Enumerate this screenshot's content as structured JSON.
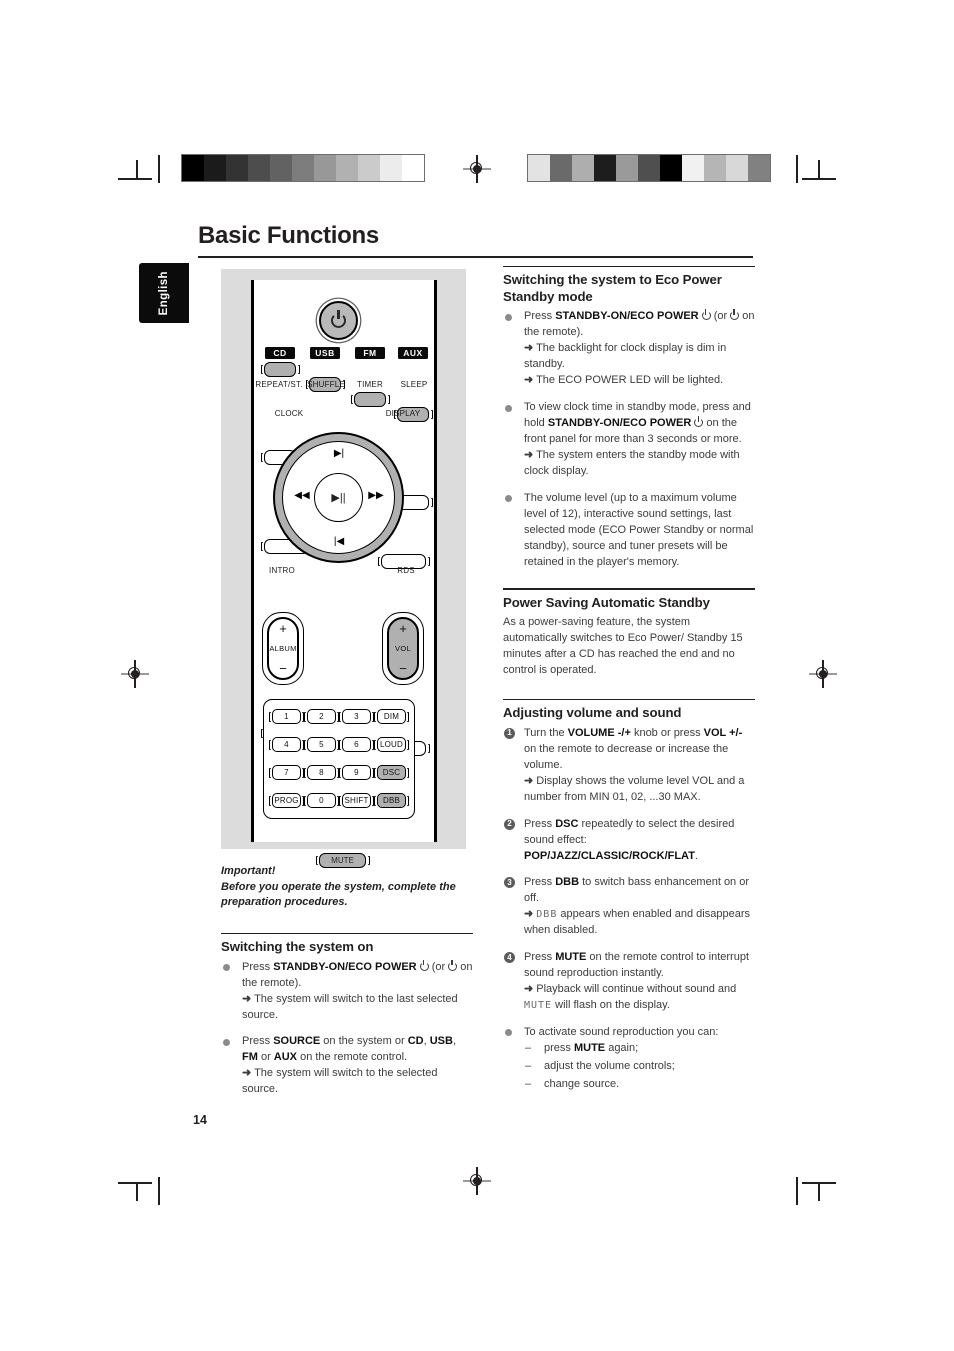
{
  "page": {
    "title": "Basic Functions",
    "number": "14",
    "language_tab": "English"
  },
  "print_marks": {
    "left_bar_swatches": [
      "#000000",
      "#1b1b1b",
      "#333333",
      "#4d4d4d",
      "#626262",
      "#7d7d7d",
      "#989898",
      "#b1b1b1",
      "#cbcbcb",
      "#ececec",
      "#ffffff"
    ],
    "right_bar_swatches": [
      "#e3e3e3",
      "#6a6a6a",
      "#aeaeae",
      "#1d1d1d",
      "#9a9a9a",
      "#4f4f4f",
      "#000000",
      "#f1f1f1",
      "#b5b5b5",
      "#d8d8d8",
      "#818181"
    ]
  },
  "remote": {
    "power_button": "power-icon",
    "source_tags": [
      "CD",
      "USB",
      "FM",
      "AUX"
    ],
    "row2_labels": [
      "REPEAT/ST.",
      "SHUFFLE",
      "TIMER",
      "SLEEP"
    ],
    "row3_labels": [
      "CLOCK",
      "DISPLAY"
    ],
    "nav": {
      "up": "▶|",
      "left": "◀◀",
      "right": "▶▶",
      "down": "|◀",
      "center": "▶||"
    },
    "nav_side_labels": [
      "INTRO",
      "RDS"
    ],
    "album_rocker": {
      "plus": "+",
      "name": "ALBUM",
      "minus": "−"
    },
    "vol_rocker": {
      "plus": "+",
      "name": "VOL",
      "minus": "−"
    },
    "stop_button": "■",
    "mute_button": "MUTE",
    "keypad": [
      [
        "1",
        "2",
        "3",
        "DIM"
      ],
      [
        "4",
        "5",
        "6",
        "LOUD"
      ],
      [
        "7",
        "8",
        "9",
        "DSC"
      ],
      [
        "PROG",
        "0",
        "SHIFT",
        "DBB"
      ]
    ],
    "keypad_shaded": [
      "DSC",
      "DBB"
    ]
  },
  "left_column": {
    "important_heading": "Important!",
    "important_text": "Before you operate the system, complete the preparation procedures.",
    "section_title": "Switching the system on",
    "bullets": [
      {
        "lead": "Press ",
        "bold1": "STANDBY-ON/ECO POWER",
        "after1": " ⏻ (or ⏻ on the remote).",
        "arrows": [
          "The system will switch to the last selected source."
        ]
      },
      {
        "lead": "Press ",
        "bold1": "SOURCE",
        "after1": " on the system or CD, USB, FM or AUX on the remote control.",
        "arrows": [
          "The system will switch to the selected source."
        ]
      }
    ]
  },
  "right_column": {
    "section1_title": "Switching the system to Eco Power Standby mode",
    "section1_bullets": [
      {
        "text_before": "Press ",
        "bold": "STANDBY-ON/ECO POWER",
        "text_after": " ⏻ (or ⏻ on the remote).",
        "arrows": [
          "The backlight for clock display is dim in standby.",
          "The ECO POWER LED will be lighted."
        ]
      },
      {
        "text_before": "To view clock time in standby mode, press and hold ",
        "bold": "STANDBY-ON/ECO POWER",
        "text_after": " ⏻ on the front panel for more than 3 seconds or more.",
        "arrows": [
          "The system enters the standby mode with clock display."
        ]
      },
      {
        "text_before": "The volume level (up to a maximum volume level of 12), interactive sound settings, last selected mode (ECO Power  Standby or normal standby), source and tuner presets will be retained in the player's memory.",
        "bold": "",
        "text_after": "",
        "arrows": []
      }
    ],
    "section2_title": "Power Saving Automatic Standby",
    "section2_body": "As a power-saving feature, the system automatically switches to Eco Power/ Standby 15 minutes after a CD has reached the end and no control is operated.",
    "section3_title": "Adjusting volume and sound",
    "section3_steps": [
      {
        "num": "1",
        "segments": [
          {
            "t": "Turn the ",
            "b": false
          },
          {
            "t": "VOLUME -/+",
            "b": true
          },
          {
            "t": " knob or press ",
            "b": false
          },
          {
            "t": "VOL +/-",
            "b": true
          },
          {
            "t": " on the remote to decrease or increase the volume.",
            "b": false
          }
        ],
        "arrows": [
          "Display shows the volume level VOL and a number from MIN 01, 02, ...30 MAX."
        ],
        "lcd_arrows": []
      },
      {
        "num": "2",
        "segments": [
          {
            "t": "Press ",
            "b": false
          },
          {
            "t": "DSC",
            "b": true
          },
          {
            "t": " repeatedly to select the desired sound effect: ",
            "b": false
          },
          {
            "t": "POP/JAZZ/CLASSIC/ROCK/FLAT",
            "b": true
          },
          {
            "t": ".",
            "b": false
          }
        ],
        "arrows": [],
        "lcd_arrows": []
      },
      {
        "num": "3",
        "segments": [
          {
            "t": "Press ",
            "b": false
          },
          {
            "t": "DBB",
            "b": true
          },
          {
            "t": " to switch bass enhancement on or off.",
            "b": false
          }
        ],
        "arrows": [],
        "lcd_arrows": [
          {
            "lcd": "DBB",
            "rest": " appears when enabled and disappears when disabled."
          }
        ]
      },
      {
        "num": "4",
        "segments": [
          {
            "t": "Press ",
            "b": false
          },
          {
            "t": "MUTE",
            "b": true
          },
          {
            "t": " on the remote control to interrupt sound reproduction instantly.",
            "b": false
          }
        ],
        "arrows": [],
        "lcd_arrows": [
          {
            "lcd_after_text": "Playback will continue without sound and ",
            "lcd": "MUTE",
            "rest": " will flash on the display."
          }
        ]
      }
    ],
    "final_bullet": {
      "lead": "To activate sound reproduction you can:",
      "items": [
        {
          "pre": "press ",
          "bold": "MUTE",
          "post": " again;"
        },
        {
          "pre": "adjust the volume controls;",
          "bold": "",
          "post": ""
        },
        {
          "pre": "change source.",
          "bold": "",
          "post": ""
        }
      ]
    }
  }
}
